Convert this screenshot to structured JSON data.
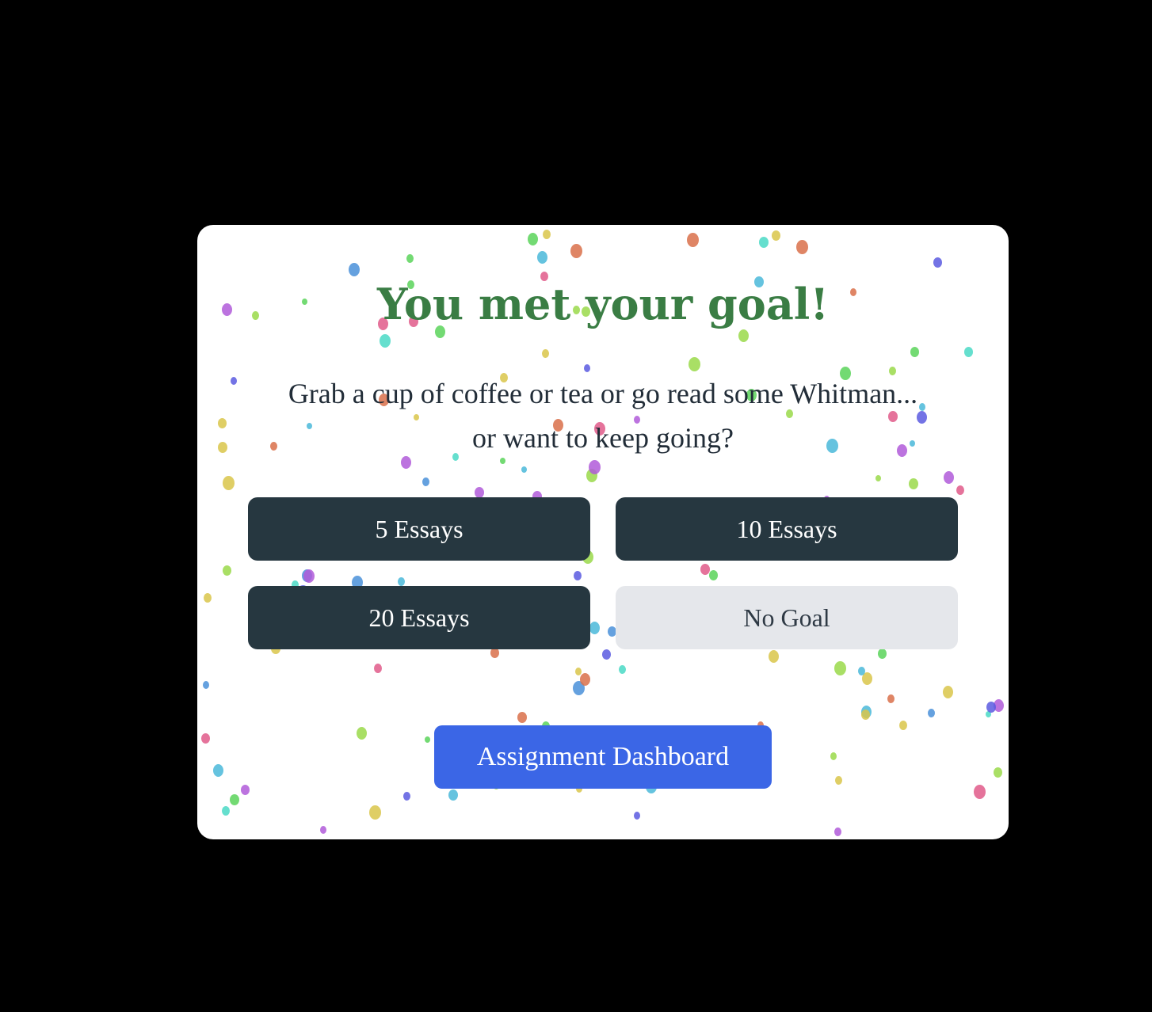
{
  "modal": {
    "title": "You met your goal!",
    "subtitle_line1": "Grab a cup of coffee or tea or go read some Whitman...",
    "subtitle_line2": "or want to keep going?",
    "goal_options": [
      {
        "label": "5 Essays"
      },
      {
        "label": "10 Essays"
      },
      {
        "label": "20 Essays"
      },
      {
        "label": "No Goal"
      }
    ],
    "dashboard_button_label": "Assignment Dashboard"
  },
  "colors": {
    "backdrop": "#000000",
    "title": "#3a7d44",
    "goal_button_dark": "#263740",
    "goal_button_light": "#e5e7eb",
    "primary_button": "#3b66e6",
    "confetti_palette": [
      "#e05a8a",
      "#5ad35a",
      "#4a90d9",
      "#d9c64a",
      "#b05ad9",
      "#4ad9c6",
      "#d9704a",
      "#5a5ae0",
      "#9ad94a",
      "#4ab8d9"
    ]
  }
}
